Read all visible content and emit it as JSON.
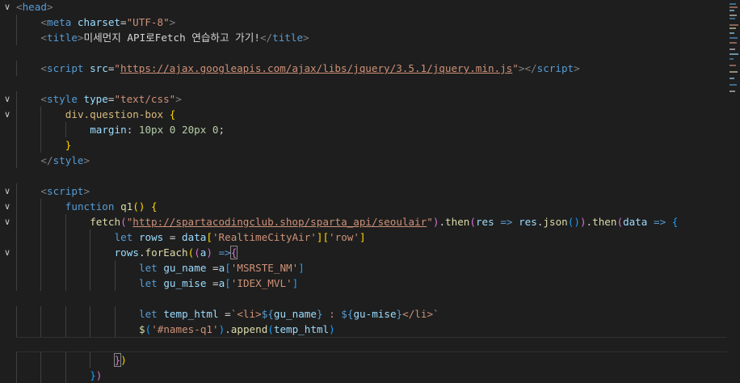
{
  "editor": {
    "lines": [
      {
        "fold": "∨",
        "indent": 0,
        "tokens": [
          [
            "t-punc",
            "<"
          ],
          [
            "t-tag",
            "head"
          ],
          [
            "t-punc",
            ">"
          ]
        ]
      },
      {
        "fold": "",
        "indent": 1,
        "tokens": [
          [
            "t-punc",
            "<"
          ],
          [
            "t-tag",
            "meta"
          ],
          [
            "t-text",
            " "
          ],
          [
            "t-attr",
            "charset"
          ],
          [
            "t-text",
            "="
          ],
          [
            "t-str",
            "\"UTF-8\""
          ],
          [
            "t-punc",
            ">"
          ]
        ]
      },
      {
        "fold": "",
        "indent": 1,
        "tokens": [
          [
            "t-punc",
            "<"
          ],
          [
            "t-tag",
            "title"
          ],
          [
            "t-punc",
            ">"
          ],
          [
            "t-text",
            "미세먼지 API로Fetch 연습하고 가기!"
          ],
          [
            "t-punc",
            "</"
          ],
          [
            "t-tag",
            "title"
          ],
          [
            "t-punc",
            ">"
          ]
        ]
      },
      {
        "fold": "",
        "indent": 0,
        "tokens": []
      },
      {
        "fold": "",
        "indent": 1,
        "tokens": [
          [
            "t-punc",
            "<"
          ],
          [
            "t-tag",
            "script"
          ],
          [
            "t-text",
            " "
          ],
          [
            "t-attr",
            "src"
          ],
          [
            "t-text",
            "="
          ],
          [
            "t-str",
            "\""
          ],
          [
            "t-link",
            "https://ajax.googleapis.com/ajax/libs/jquery/3.5.1/jquery.min.js"
          ],
          [
            "t-str",
            "\""
          ],
          [
            "t-punc",
            "></"
          ],
          [
            "t-tag",
            "script"
          ],
          [
            "t-punc",
            ">"
          ]
        ]
      },
      {
        "fold": "",
        "indent": 0,
        "tokens": []
      },
      {
        "fold": "∨",
        "indent": 1,
        "tokens": [
          [
            "t-punc",
            "<"
          ],
          [
            "t-tag",
            "style"
          ],
          [
            "t-text",
            " "
          ],
          [
            "t-attr",
            "type"
          ],
          [
            "t-text",
            "="
          ],
          [
            "t-str",
            "\"text/css\""
          ],
          [
            "t-punc",
            ">"
          ]
        ]
      },
      {
        "fold": "∨",
        "indent": 2,
        "tokens": [
          [
            "t-sel",
            "div.question-box"
          ],
          [
            "t-text",
            " "
          ],
          [
            "t-br1",
            "{"
          ]
        ]
      },
      {
        "fold": "",
        "indent": 3,
        "tokens": [
          [
            "t-attr",
            "margin"
          ],
          [
            "t-text",
            ": "
          ],
          [
            "t-num",
            "10px"
          ],
          [
            "t-text",
            " "
          ],
          [
            "t-num",
            "0"
          ],
          [
            "t-text",
            " "
          ],
          [
            "t-num",
            "20px"
          ],
          [
            "t-text",
            " "
          ],
          [
            "t-num",
            "0"
          ],
          [
            "t-text",
            ";"
          ]
        ]
      },
      {
        "fold": "",
        "indent": 2,
        "tokens": [
          [
            "t-br1",
            "}"
          ]
        ]
      },
      {
        "fold": "",
        "indent": 1,
        "tokens": [
          [
            "t-punc",
            "</"
          ],
          [
            "t-tag",
            "style"
          ],
          [
            "t-punc",
            ">"
          ]
        ]
      },
      {
        "fold": "",
        "indent": 0,
        "tokens": []
      },
      {
        "fold": "∨",
        "indent": 1,
        "tokens": [
          [
            "t-punc",
            "<"
          ],
          [
            "t-tag",
            "script"
          ],
          [
            "t-punc",
            ">"
          ]
        ]
      },
      {
        "fold": "∨",
        "indent": 2,
        "tokens": [
          [
            "t-kw",
            "function"
          ],
          [
            "t-text",
            " "
          ],
          [
            "t-fn",
            "q1"
          ],
          [
            "t-br1",
            "()"
          ],
          [
            "t-text",
            " "
          ],
          [
            "t-br1",
            "{"
          ]
        ]
      },
      {
        "fold": "∨",
        "indent": 3,
        "tokens": [
          [
            "t-fn",
            "fetch"
          ],
          [
            "t-br2",
            "("
          ],
          [
            "t-str",
            "\""
          ],
          [
            "t-link",
            "http://spartacodingclub.shop/sparta_api/seoulair"
          ],
          [
            "t-str",
            "\""
          ],
          [
            "t-br2",
            ")"
          ],
          [
            "t-text",
            "."
          ],
          [
            "t-fn",
            "then"
          ],
          [
            "t-br2",
            "("
          ],
          [
            "t-var",
            "res"
          ],
          [
            "t-text",
            " "
          ],
          [
            "t-kw",
            "=>"
          ],
          [
            "t-text",
            " "
          ],
          [
            "t-var",
            "res"
          ],
          [
            "t-text",
            "."
          ],
          [
            "t-fn",
            "json"
          ],
          [
            "t-br3",
            "()"
          ],
          [
            "t-br2",
            ")"
          ],
          [
            "t-text",
            "."
          ],
          [
            "t-fn",
            "then"
          ],
          [
            "t-br2",
            "("
          ],
          [
            "t-var",
            "data"
          ],
          [
            "t-text",
            " "
          ],
          [
            "t-kw",
            "=>"
          ],
          [
            "t-text",
            " "
          ],
          [
            "t-br3",
            "{"
          ]
        ]
      },
      {
        "fold": "",
        "indent": 4,
        "tokens": [
          [
            "t-kw",
            "let"
          ],
          [
            "t-text",
            " "
          ],
          [
            "t-var",
            "rows"
          ],
          [
            "t-text",
            " = "
          ],
          [
            "t-var",
            "data"
          ],
          [
            "t-br1",
            "["
          ],
          [
            "t-str",
            "'RealtimeCityAir'"
          ],
          [
            "t-br1",
            "]["
          ],
          [
            "t-str",
            "'row'"
          ],
          [
            "t-br1",
            "]"
          ]
        ]
      },
      {
        "fold": "∨",
        "indent": 4,
        "tokens": [
          [
            "t-var",
            "rows"
          ],
          [
            "t-text",
            "."
          ],
          [
            "t-fn",
            "forEach"
          ],
          [
            "t-br1",
            "("
          ],
          [
            "t-br2",
            "("
          ],
          [
            "t-var",
            "a"
          ],
          [
            "t-br2",
            ")"
          ],
          [
            "t-text",
            " "
          ],
          [
            "t-kw",
            "=>"
          ],
          [
            "t-br2 t-bhl",
            "{"
          ]
        ]
      },
      {
        "fold": "",
        "indent": 5,
        "tokens": [
          [
            "t-kw",
            "let"
          ],
          [
            "t-text",
            " "
          ],
          [
            "t-var",
            "gu_name"
          ],
          [
            "t-text",
            " ="
          ],
          [
            "t-var",
            "a"
          ],
          [
            "t-br3",
            "["
          ],
          [
            "t-str",
            "'MSRSTE_NM'"
          ],
          [
            "t-br3",
            "]"
          ]
        ]
      },
      {
        "fold": "",
        "indent": 5,
        "tokens": [
          [
            "t-kw",
            "let"
          ],
          [
            "t-text",
            " "
          ],
          [
            "t-var",
            "gu_mise"
          ],
          [
            "t-text",
            " ="
          ],
          [
            "t-var",
            "a"
          ],
          [
            "t-br3",
            "["
          ],
          [
            "t-str",
            "'IDEX_MVL'"
          ],
          [
            "t-br3",
            "]"
          ]
        ]
      },
      {
        "fold": "",
        "indent": 0,
        "tokens": []
      },
      {
        "fold": "",
        "indent": 5,
        "tokens": [
          [
            "t-kw",
            "let"
          ],
          [
            "t-text",
            " "
          ],
          [
            "t-var",
            "temp_html"
          ],
          [
            "t-text",
            " ="
          ],
          [
            "t-str",
            "`<li>"
          ],
          [
            "t-kw",
            "${"
          ],
          [
            "t-var",
            "gu_name"
          ],
          [
            "t-kw",
            "}"
          ],
          [
            "t-str",
            " : "
          ],
          [
            "t-kw",
            "${"
          ],
          [
            "t-var",
            "gu-mise"
          ],
          [
            "t-kw",
            "}"
          ],
          [
            "t-str",
            "</li>`"
          ]
        ]
      },
      {
        "fold": "",
        "indent": 5,
        "tokens": [
          [
            "t-fn",
            "$"
          ],
          [
            "t-br3",
            "("
          ],
          [
            "t-str",
            "'#names-q1'"
          ],
          [
            "t-br3",
            ")"
          ],
          [
            "t-text",
            "."
          ],
          [
            "t-fn",
            "append"
          ],
          [
            "t-br3",
            "("
          ],
          [
            "t-var",
            "temp_html"
          ],
          [
            "t-br3",
            ")"
          ]
        ]
      },
      {
        "fold": "",
        "indent": 0,
        "tokens": []
      },
      {
        "fold": "",
        "indent": 4,
        "tokens": [
          [
            "t-br2 t-bhl",
            "}"
          ],
          [
            "t-br1",
            ")"
          ]
        ]
      },
      {
        "fold": "",
        "indent": 3,
        "tokens": [
          [
            "t-br3",
            "}"
          ],
          [
            "t-br2",
            ")"
          ]
        ]
      }
    ]
  }
}
